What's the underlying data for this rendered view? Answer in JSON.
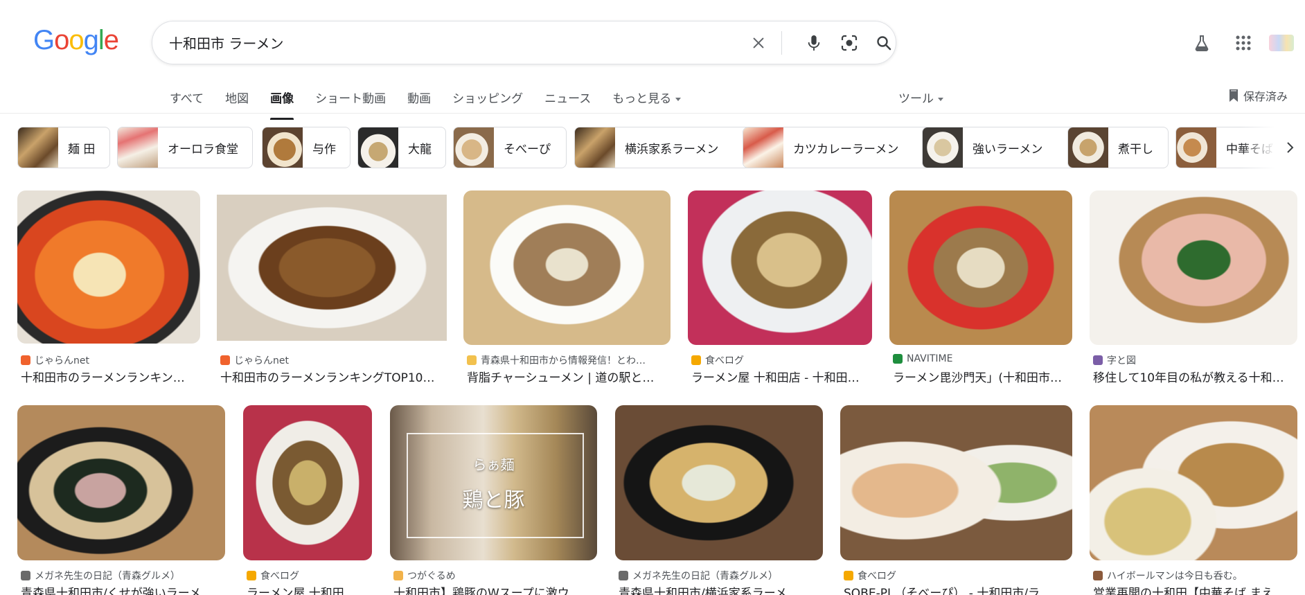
{
  "logo": {
    "text": "Google",
    "letters": [
      "G",
      "o",
      "o",
      "g",
      "l",
      "e"
    ]
  },
  "search": {
    "query": "十和田市 ラーメン"
  },
  "icons": {
    "clear": "close-icon",
    "voice": "microphone-icon",
    "lens": "camera-lens-icon",
    "search": "search-icon",
    "labs": "flask-icon",
    "apps": "apps-grid-icon",
    "saved": "bookmark-icon",
    "next": "chevron-right-icon"
  },
  "nav": {
    "tabs": [
      "すべて",
      "地図",
      "画像",
      "ショート動画",
      "動画",
      "ショッピング",
      "ニュース",
      "もっと見る"
    ],
    "active": "画像",
    "tools": "ツール",
    "saved": "保存済み"
  },
  "chips": [
    "麺 田",
    "オーロラ食堂",
    "与作",
    "大龍",
    "そべーぴ",
    "横浜家系ラーメン",
    "カツカレーラーメン",
    "強いラーメン",
    "煮干し",
    "中華そば"
  ],
  "results": [
    {
      "source": "じゃらんnet",
      "title": "十和田市のラーメンランキン…"
    },
    {
      "source": "じゃらんnet",
      "title": "十和田市のラーメンランキングTOP10…"
    },
    {
      "source": "青森県十和田市から情報発信！とわ…",
      "title": "背脂チャーシューメン | 道の駅と…"
    },
    {
      "source": "食べログ",
      "title": "ラーメン屋 十和田店 - 十和田…"
    },
    {
      "source": "NAVITIME",
      "title": "ラーメン毘沙門天」(十和田市…"
    },
    {
      "source": "字と図",
      "title": "移住して10年目の私が教える十和…"
    },
    {
      "source": "メガネ先生の日記（青森グルメ）",
      "title": "青森県十和田市/くせが強いラーメ…"
    },
    {
      "source": "食べログ",
      "title": "ラーメン屋 十和田…"
    },
    {
      "source": "つがぐるめ",
      "title": "十和田市】鶏豚のWスープに激ウ…"
    },
    {
      "source": "メガネ先生の日記（青森グルメ）",
      "title": "青森県十和田市/横浜家系ラーメ…"
    },
    {
      "source": "食べログ",
      "title": "SOBE-PI （そべーぴ） - 十和田市/ラ…"
    },
    {
      "source": "ハイボールマンは今日も呑む。",
      "title": "営業再開の十和田【中華そば まえ…"
    }
  ],
  "image_overlay": {
    "line1": "らぁ麺",
    "line2": "鶏と豚"
  },
  "colors": {
    "google_blue": "#4285F4",
    "google_red": "#EA4335",
    "google_yellow": "#FBBC05",
    "google_green": "#34A853",
    "jalan": "#F0622D",
    "tabelog": "#F5A800",
    "navitime": "#1E8E3E"
  }
}
